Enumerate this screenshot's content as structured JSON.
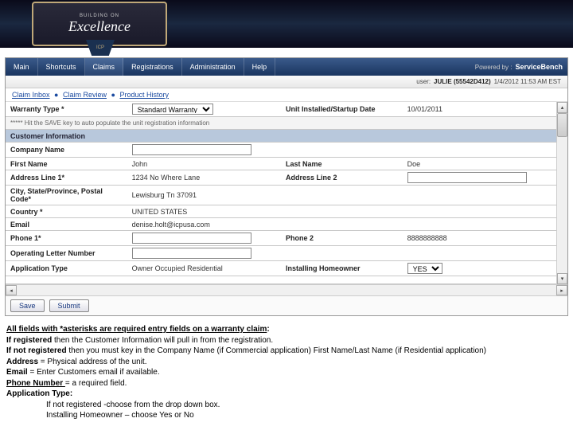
{
  "logo": {
    "top": "BUILDING ON",
    "main": "Excellence",
    "ribbon": "ICP"
  },
  "nav": {
    "items": [
      {
        "label": "Main"
      },
      {
        "label": "Shortcuts"
      },
      {
        "label": "Claims"
      },
      {
        "label": "Registrations"
      },
      {
        "label": "Administration"
      },
      {
        "label": "Help"
      }
    ],
    "powered_label": "Powered by :",
    "powered_brand": "ServiceBench"
  },
  "userbar": {
    "label": "user:",
    "name": "JULIE (55542D412)",
    "timestamp": "1/4/2012 11:53 AM EST"
  },
  "breadcrumb": {
    "a": "Claim Inbox",
    "b": "Claim Review",
    "c": "Product History"
  },
  "form": {
    "warranty_type_label": "Warranty Type *",
    "warranty_type_value": "Standard Warranty",
    "unit_date_label": "Unit Installed/Startup Date",
    "unit_date_value": "10/01/2011",
    "hint": "***** Hit the SAVE key to auto populate the unit registration information",
    "section_customer": "Customer Information",
    "company_label": "Company Name",
    "first_label": "First Name",
    "first_value": "John",
    "last_label": "Last Name",
    "last_value": "Doe",
    "addr1_label": "Address Line 1*",
    "addr1_value": "1234 No Where Lane",
    "addr2_label": "Address Line 2",
    "city_label": "City, State/Province, Postal Code*",
    "city_value": "Lewisburg  Tn  37091",
    "country_label": "Country *",
    "country_value": "UNITED STATES",
    "email_label": "Email",
    "email_value": "denise.holt@icpusa.com",
    "phone1_label": "Phone 1*",
    "phone2_label": "Phone 2",
    "phone2_value": "8888888888",
    "oln_label": "Operating Letter Number",
    "apptype_label": "Application Type",
    "apptype_value": "Owner Occupied Residential",
    "insthome_label": "Installing Homeowner",
    "insthome_value": "YES"
  },
  "buttons": {
    "save": "Save",
    "submit": "Submit"
  },
  "instructions": {
    "l1a": "All fields with *asterisks are required entry fields on a warranty claim",
    "l1b": ":",
    "l2a": "If registered",
    "l2b": " then the Customer Information will pull in from the registration.",
    "l3a": "If not registered",
    "l3b": " then you must key in the Company Name (if Commercial application) First Name/Last Name (if Residential application)",
    "l4a": "Address",
    "l4b": " = Physical address of the unit.",
    "l5a": "Email",
    "l5b": " = Enter Customers email if available.",
    "l6a": "Phone Number ",
    "l6b": " = a required field.",
    "l7": "Application  Type:",
    "l8": "If not registered  -choose from the drop down box.",
    "l9": "Installing Homeowner – choose Yes or No"
  }
}
